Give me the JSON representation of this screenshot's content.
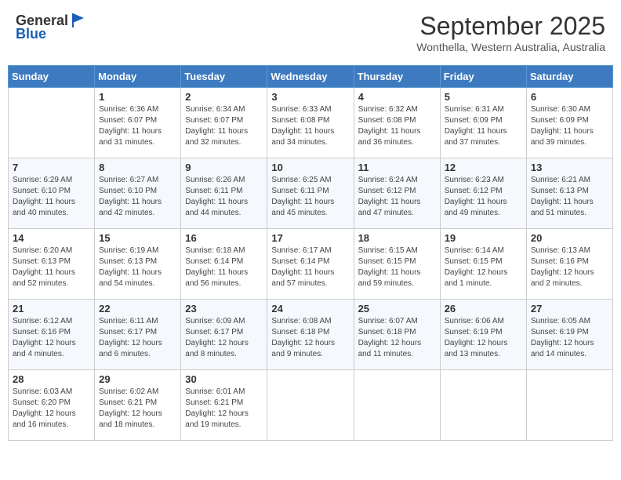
{
  "logo": {
    "general": "General",
    "blue": "Blue"
  },
  "title": "September 2025",
  "subtitle": "Wonthella, Western Australia, Australia",
  "headers": [
    "Sunday",
    "Monday",
    "Tuesday",
    "Wednesday",
    "Thursday",
    "Friday",
    "Saturday"
  ],
  "weeks": [
    [
      {
        "day": "",
        "sunrise": "",
        "sunset": "",
        "daylight": ""
      },
      {
        "day": "1",
        "sunrise": "Sunrise: 6:36 AM",
        "sunset": "Sunset: 6:07 PM",
        "daylight": "Daylight: 11 hours and 31 minutes."
      },
      {
        "day": "2",
        "sunrise": "Sunrise: 6:34 AM",
        "sunset": "Sunset: 6:07 PM",
        "daylight": "Daylight: 11 hours and 32 minutes."
      },
      {
        "day": "3",
        "sunrise": "Sunrise: 6:33 AM",
        "sunset": "Sunset: 6:08 PM",
        "daylight": "Daylight: 11 hours and 34 minutes."
      },
      {
        "day": "4",
        "sunrise": "Sunrise: 6:32 AM",
        "sunset": "Sunset: 6:08 PM",
        "daylight": "Daylight: 11 hours and 36 minutes."
      },
      {
        "day": "5",
        "sunrise": "Sunrise: 6:31 AM",
        "sunset": "Sunset: 6:09 PM",
        "daylight": "Daylight: 11 hours and 37 minutes."
      },
      {
        "day": "6",
        "sunrise": "Sunrise: 6:30 AM",
        "sunset": "Sunset: 6:09 PM",
        "daylight": "Daylight: 11 hours and 39 minutes."
      }
    ],
    [
      {
        "day": "7",
        "sunrise": "Sunrise: 6:29 AM",
        "sunset": "Sunset: 6:10 PM",
        "daylight": "Daylight: 11 hours and 40 minutes."
      },
      {
        "day": "8",
        "sunrise": "Sunrise: 6:27 AM",
        "sunset": "Sunset: 6:10 PM",
        "daylight": "Daylight: 11 hours and 42 minutes."
      },
      {
        "day": "9",
        "sunrise": "Sunrise: 6:26 AM",
        "sunset": "Sunset: 6:11 PM",
        "daylight": "Daylight: 11 hours and 44 minutes."
      },
      {
        "day": "10",
        "sunrise": "Sunrise: 6:25 AM",
        "sunset": "Sunset: 6:11 PM",
        "daylight": "Daylight: 11 hours and 45 minutes."
      },
      {
        "day": "11",
        "sunrise": "Sunrise: 6:24 AM",
        "sunset": "Sunset: 6:12 PM",
        "daylight": "Daylight: 11 hours and 47 minutes."
      },
      {
        "day": "12",
        "sunrise": "Sunrise: 6:23 AM",
        "sunset": "Sunset: 6:12 PM",
        "daylight": "Daylight: 11 hours and 49 minutes."
      },
      {
        "day": "13",
        "sunrise": "Sunrise: 6:21 AM",
        "sunset": "Sunset: 6:13 PM",
        "daylight": "Daylight: 11 hours and 51 minutes."
      }
    ],
    [
      {
        "day": "14",
        "sunrise": "Sunrise: 6:20 AM",
        "sunset": "Sunset: 6:13 PM",
        "daylight": "Daylight: 11 hours and 52 minutes."
      },
      {
        "day": "15",
        "sunrise": "Sunrise: 6:19 AM",
        "sunset": "Sunset: 6:13 PM",
        "daylight": "Daylight: 11 hours and 54 minutes."
      },
      {
        "day": "16",
        "sunrise": "Sunrise: 6:18 AM",
        "sunset": "Sunset: 6:14 PM",
        "daylight": "Daylight: 11 hours and 56 minutes."
      },
      {
        "day": "17",
        "sunrise": "Sunrise: 6:17 AM",
        "sunset": "Sunset: 6:14 PM",
        "daylight": "Daylight: 11 hours and 57 minutes."
      },
      {
        "day": "18",
        "sunrise": "Sunrise: 6:15 AM",
        "sunset": "Sunset: 6:15 PM",
        "daylight": "Daylight: 11 hours and 59 minutes."
      },
      {
        "day": "19",
        "sunrise": "Sunrise: 6:14 AM",
        "sunset": "Sunset: 6:15 PM",
        "daylight": "Daylight: 12 hours and 1 minute."
      },
      {
        "day": "20",
        "sunrise": "Sunrise: 6:13 AM",
        "sunset": "Sunset: 6:16 PM",
        "daylight": "Daylight: 12 hours and 2 minutes."
      }
    ],
    [
      {
        "day": "21",
        "sunrise": "Sunrise: 6:12 AM",
        "sunset": "Sunset: 6:16 PM",
        "daylight": "Daylight: 12 hours and 4 minutes."
      },
      {
        "day": "22",
        "sunrise": "Sunrise: 6:11 AM",
        "sunset": "Sunset: 6:17 PM",
        "daylight": "Daylight: 12 hours and 6 minutes."
      },
      {
        "day": "23",
        "sunrise": "Sunrise: 6:09 AM",
        "sunset": "Sunset: 6:17 PM",
        "daylight": "Daylight: 12 hours and 8 minutes."
      },
      {
        "day": "24",
        "sunrise": "Sunrise: 6:08 AM",
        "sunset": "Sunset: 6:18 PM",
        "daylight": "Daylight: 12 hours and 9 minutes."
      },
      {
        "day": "25",
        "sunrise": "Sunrise: 6:07 AM",
        "sunset": "Sunset: 6:18 PM",
        "daylight": "Daylight: 12 hours and 11 minutes."
      },
      {
        "day": "26",
        "sunrise": "Sunrise: 6:06 AM",
        "sunset": "Sunset: 6:19 PM",
        "daylight": "Daylight: 12 hours and 13 minutes."
      },
      {
        "day": "27",
        "sunrise": "Sunrise: 6:05 AM",
        "sunset": "Sunset: 6:19 PM",
        "daylight": "Daylight: 12 hours and 14 minutes."
      }
    ],
    [
      {
        "day": "28",
        "sunrise": "Sunrise: 6:03 AM",
        "sunset": "Sunset: 6:20 PM",
        "daylight": "Daylight: 12 hours and 16 minutes."
      },
      {
        "day": "29",
        "sunrise": "Sunrise: 6:02 AM",
        "sunset": "Sunset: 6:21 PM",
        "daylight": "Daylight: 12 hours and 18 minutes."
      },
      {
        "day": "30",
        "sunrise": "Sunrise: 6:01 AM",
        "sunset": "Sunset: 6:21 PM",
        "daylight": "Daylight: 12 hours and 19 minutes."
      },
      {
        "day": "",
        "sunrise": "",
        "sunset": "",
        "daylight": ""
      },
      {
        "day": "",
        "sunrise": "",
        "sunset": "",
        "daylight": ""
      },
      {
        "day": "",
        "sunrise": "",
        "sunset": "",
        "daylight": ""
      },
      {
        "day": "",
        "sunrise": "",
        "sunset": "",
        "daylight": ""
      }
    ]
  ]
}
